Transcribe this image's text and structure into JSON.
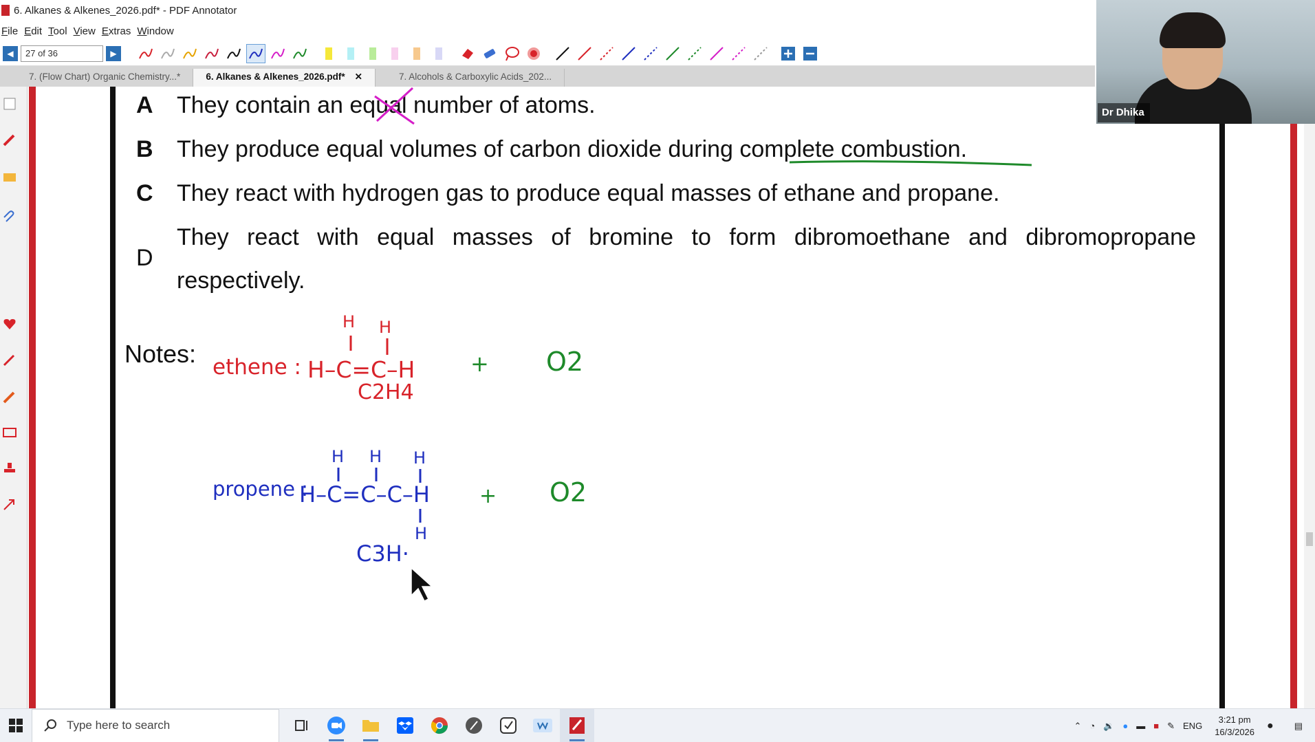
{
  "window": {
    "title": "6. Alkanes & Alkenes_2026.pdf* - PDF Annotator"
  },
  "menu": {
    "items": [
      "File",
      "Edit",
      "Tool",
      "View",
      "Extras",
      "Window"
    ]
  },
  "toolbar": {
    "page_indicator": "27 of 36",
    "prev_icon": "triangle-left-icon",
    "next_icon": "triangle-right-icon"
  },
  "tabs": [
    {
      "label": "7. (Flow Chart) Organic Chemistry...*",
      "active": false
    },
    {
      "label": "6. Alkanes & Alkenes_2026.pdf*",
      "active": true,
      "close": "✕"
    },
    {
      "label": "7. Alcohols & Carboxylic Acids_202...",
      "active": false
    }
  ],
  "document": {
    "options": [
      {
        "letter": "A",
        "text": "They contain an equal number of atoms."
      },
      {
        "letter": "B",
        "text": "They produce equal volumes of carbon dioxide during complete combustion."
      },
      {
        "letter": "C",
        "text": "They react with hydrogen gas to produce equal masses of ethane and propane."
      },
      {
        "letter": "D",
        "text_line1": "They react with equal masses of bromine to form dibromoethane and dibromopropane",
        "text_line2": "respectively."
      }
    ],
    "notes_label": "Notes:",
    "handwriting": {
      "ethene_label": "ethene :",
      "ethene_formula": "C2H4",
      "ethene_structure": "H–C=C–H",
      "h": "H",
      "plus": "+",
      "o2": "O2",
      "propene_label": "propene :",
      "propene_structure": "H–C=C–C–H",
      "propene_formula_partial": "C3H·"
    },
    "colors": {
      "red_ink": "#d8232a",
      "blue_ink": "#1f2fbf",
      "green_ink": "#1e8a2a"
    }
  },
  "webcam": {
    "name": "Dr Dhika"
  },
  "taskbar": {
    "search_placeholder": "Type here to search",
    "language": "ENG",
    "time": "3:21 pm",
    "date": "16/3/2026"
  }
}
